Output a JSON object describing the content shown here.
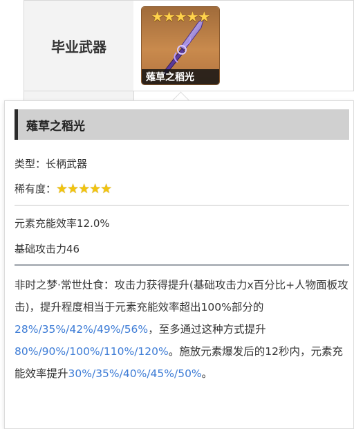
{
  "table": {
    "row_label": "毕业武器"
  },
  "weapon": {
    "name": "薙草之稻光",
    "stars": "★★★★★",
    "type_label": "类型：长柄武器",
    "rarity_label": "稀有度：",
    "rarity_stars": "★★★★★",
    "stat_secondary": "元素充能效率12.0%",
    "stat_base": "基础攻击力46",
    "description": {
      "p1": "非时之梦·常世灶食：攻击力获得提升(基础攻击力x百分比+人物面板攻击)，提升程度相当于元素充能效率超出100%部分的",
      "v1": "28%/35%/42%/49%/56%",
      "p2": "，至多通过这种方式提升",
      "v2": "80%/90%/100%/110%/120%",
      "p3": "。施放元素爆发后的12秒内，元素充能效率提升",
      "v3": "30%/35%/40%/45%/50%",
      "p4": "。"
    }
  },
  "colors": {
    "highlight": "#3d7cd6",
    "title_bar": "#d0d0d0",
    "star": "#f1c40f"
  }
}
